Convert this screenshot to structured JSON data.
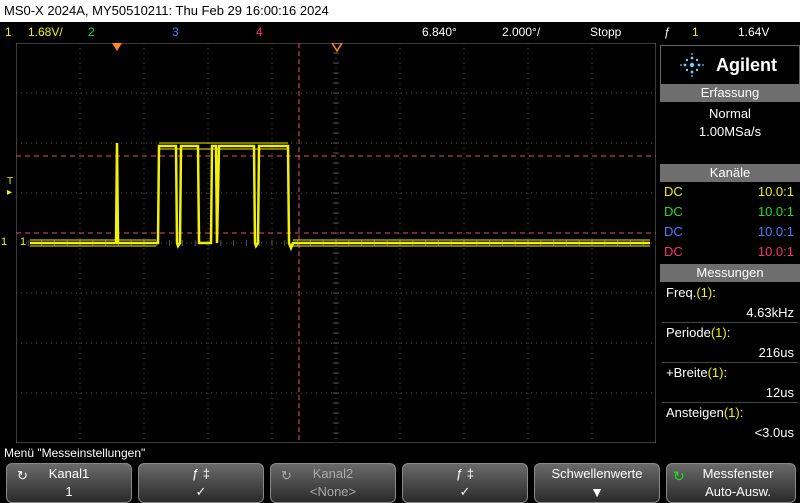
{
  "title": "MS0-X 2024A, MY50510211: Thu Feb 29 16:00:16 2024",
  "status": {
    "ch1_num": "1",
    "ch1_scale": "1.68V/",
    "ch2_num": "2",
    "ch3_num": "3",
    "ch4_num": "4",
    "delay": "6.840°",
    "timebase": "2.000°/",
    "run_state": "Stopp",
    "trigger_icon": "ƒ",
    "trigger_ch": "1",
    "trigger_level": "1.64V"
  },
  "markers": {
    "trigger_level": "T",
    "ch1_ground": "1"
  },
  "panel": {
    "brand": "Agilent",
    "acq_header": "Erfassung",
    "acq_mode": "Normal",
    "acq_rate": "1.00MSa/s",
    "channels_header": "Kanäle",
    "channels": [
      {
        "coupling": "DC",
        "ratio": "10.0:1",
        "color": "#f2f200"
      },
      {
        "coupling": "DC",
        "ratio": "10.0:1",
        "color": "#21e021"
      },
      {
        "coupling": "DC",
        "ratio": "10.0:1",
        "color": "#4a7cff"
      },
      {
        "coupling": "DC",
        "ratio": "10.0:1",
        "color": "#ff3070"
      }
    ],
    "meas_header": "Messungen",
    "measurements": [
      {
        "label": "Freq.",
        "ch": "(1)",
        "colon": ":",
        "value": "4.63kHz"
      },
      {
        "label": "Periode",
        "ch": "(1)",
        "colon": ":",
        "value": "216us"
      },
      {
        "label": "+Breite",
        "ch": "(1)",
        "colon": ":",
        "value": "12us"
      },
      {
        "label": "Ansteigen",
        "ch": "(1)",
        "colon": ":",
        "value": "<3.0us"
      }
    ]
  },
  "menu_title": "Menü \"Messeinstellungen\"",
  "softkeys": {
    "k1_line1": "Kanal1",
    "k1_line2": "1",
    "k2_line1": "ƒ     ‡",
    "k2_line2": "✓",
    "k3_line1": "Kanal2",
    "k3_line2": "<None>",
    "k4_line1": "ƒ     ‡",
    "k4_line2": "✓",
    "k5_line1": "Schwellenwerte",
    "k6_line1": "Messfenster",
    "k6_line2": "Auto-Ausw."
  },
  "colors": {
    "ch1": "#f2f200",
    "ch2": "#21e021",
    "ch3": "#4a7cff",
    "ch4": "#ff3070",
    "trigger_marker": "#ff8c1a",
    "cursor_line": "#e0506a",
    "grid": "#555555"
  },
  "icons": {
    "brand_logo": "agilent-starburst-icon",
    "trigger_edge": "rising-edge-icon",
    "refresh": "refresh-icon",
    "arrow_down": "arrow-down-icon",
    "messfenster": "circular-arrow-icon"
  }
}
